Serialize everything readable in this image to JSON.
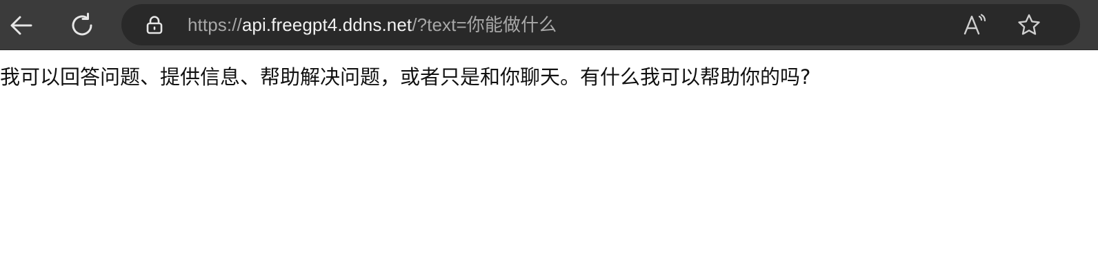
{
  "browser": {
    "url": {
      "scheme": "https://",
      "host": "api.freegpt4.ddns.net",
      "path": "/?text=你能做什么"
    },
    "icons": {
      "back": "back-arrow-icon",
      "refresh": "refresh-icon",
      "lock": "lock-icon",
      "read_aloud": "read-aloud-icon",
      "favorite": "star-icon"
    },
    "colors": {
      "toolbar_bg": "#3b3b3b",
      "address_bar_bg": "#292929",
      "url_dim": "#a8a8a8",
      "url_bright": "#f2f2f2"
    }
  },
  "page": {
    "body_text": "我可以回答问题、提供信息、帮助解决问题，或者只是和你聊天。有什么我可以帮助你的吗?"
  }
}
